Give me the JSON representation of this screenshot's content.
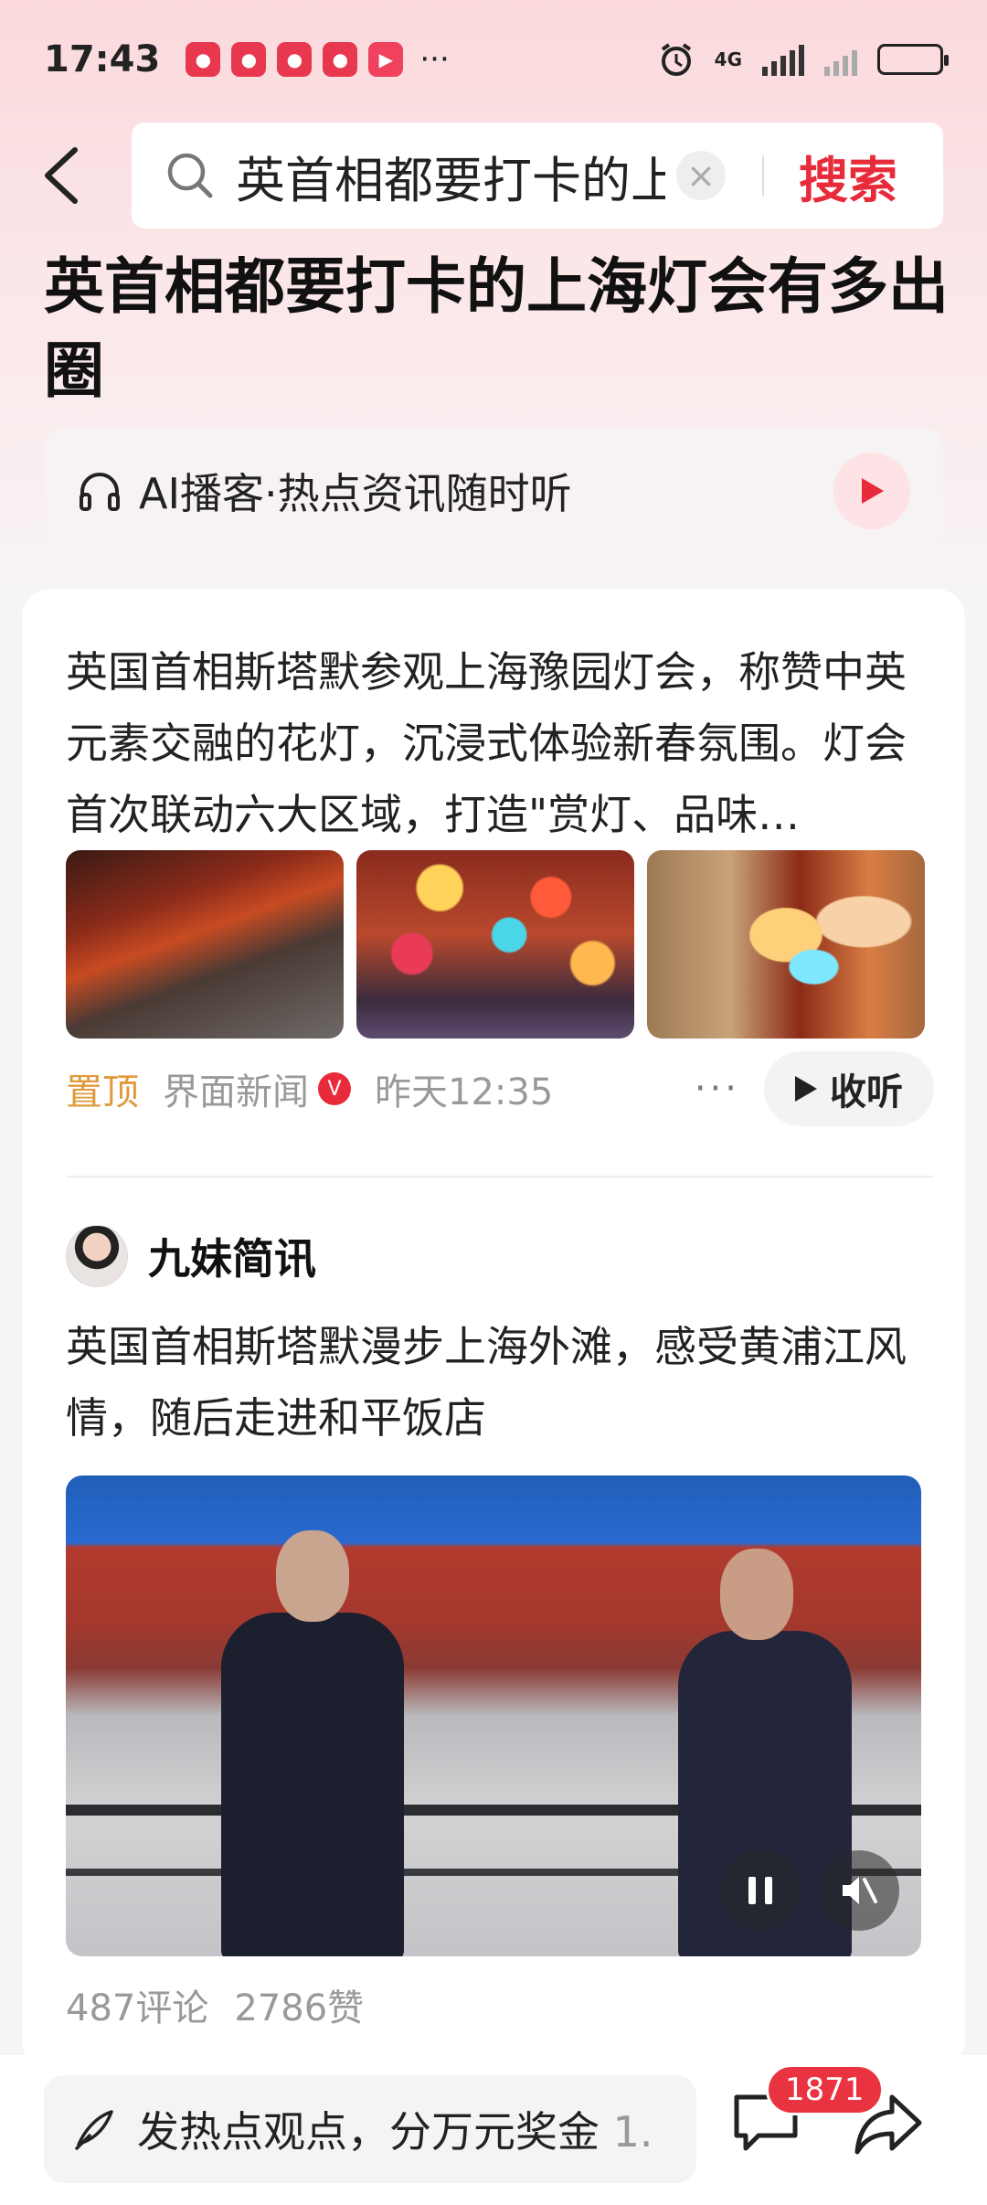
{
  "status_bar": {
    "time": "17:43",
    "network": "4G",
    "more": "···"
  },
  "search": {
    "query": "英首相都要打卡的上海灯会有多出圈",
    "clear_icon": "close-icon",
    "search_button": "搜索"
  },
  "headline": "英首相都要打卡的上海灯会有多出圈",
  "podcast": {
    "label": "AI播客·热点资讯随时听",
    "icon": "headphones-icon"
  },
  "article1": {
    "text": "英国首相斯塔默参观上海豫园灯会，称赞中英元素交融的花灯，沉浸式体验新春氛围。灯会首次联动六大区域，打造\"赏灯、品味…",
    "pinned": "置顶",
    "source": "界面新闻",
    "verified": "V",
    "time": "昨天12:35",
    "more": "···",
    "listen": "收听"
  },
  "article2": {
    "author": "九妹简讯",
    "text": "英国首相斯塔默漫步上海外滩，感受黄浦江风情，随后走进和平饭店",
    "comments": "487评论",
    "likes": "2786赞"
  },
  "bottom_bar": {
    "comment_placeholder": "发热点观点，分万元奖金",
    "comment_suffix": "1..",
    "comment_count": "1871"
  },
  "colors": {
    "accent_red": "#e82b3a",
    "pinned_orange": "#e09a3a"
  }
}
